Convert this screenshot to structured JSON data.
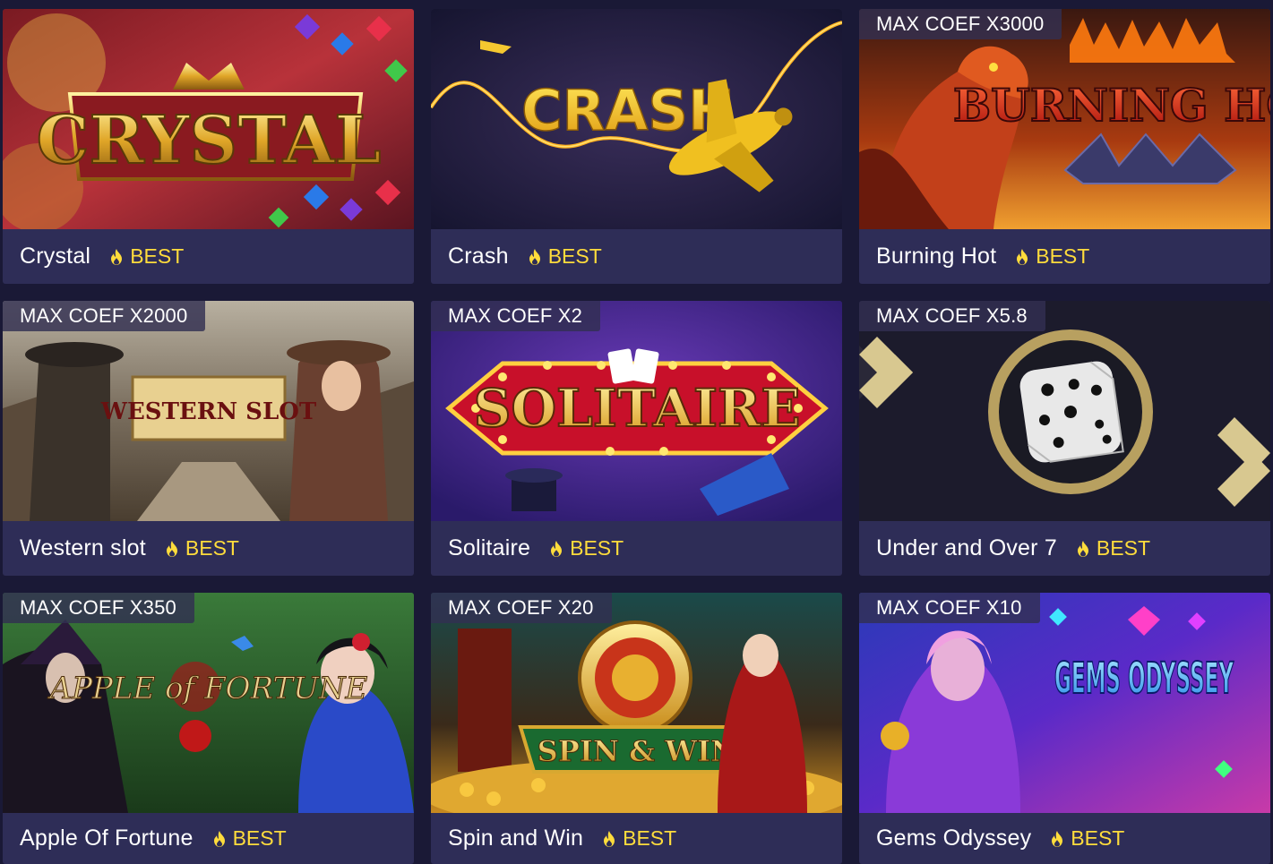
{
  "colors": {
    "page_bg": "#1a1936",
    "card_footer": "#2e2d57",
    "best_accent": "#ffdc3c",
    "text": "#ffffff"
  },
  "games": [
    {
      "name": "Crystal",
      "badge": "BEST",
      "max_coef": "",
      "art_title": "CRYSTAL",
      "art": "crystal"
    },
    {
      "name": "Crash",
      "badge": "BEST",
      "max_coef": "",
      "art_title": "CRASH",
      "art": "crash"
    },
    {
      "name": "Burning Hot",
      "badge": "BEST",
      "max_coef": "MAX COEF X3000",
      "art_title": "BURNING HOT",
      "art": "burning"
    },
    {
      "name": "Western slot",
      "badge": "BEST",
      "max_coef": "MAX COEF X2000",
      "art_title": "WESTERN SLOT",
      "art": "western"
    },
    {
      "name": "Solitaire",
      "badge": "BEST",
      "max_coef": "MAX COEF X2",
      "art_title": "SOLITAIRE",
      "art": "solitaire"
    },
    {
      "name": "Under and Over 7",
      "badge": "BEST",
      "max_coef": "MAX COEF X5.8",
      "art_title": "",
      "art": "dice"
    },
    {
      "name": "Apple Of Fortune",
      "badge": "BEST",
      "max_coef": "MAX COEF X350",
      "art_title": "APPLE of FORTUNE",
      "art": "apple"
    },
    {
      "name": "Spin and Win",
      "badge": "BEST",
      "max_coef": "MAX COEF X20",
      "art_title": "SPIN & WIN",
      "art": "spin"
    },
    {
      "name": "Gems Odyssey",
      "badge": "BEST",
      "max_coef": "MAX COEF X10",
      "art_title": "GEMS ODYSSEY",
      "art": "gems"
    }
  ]
}
